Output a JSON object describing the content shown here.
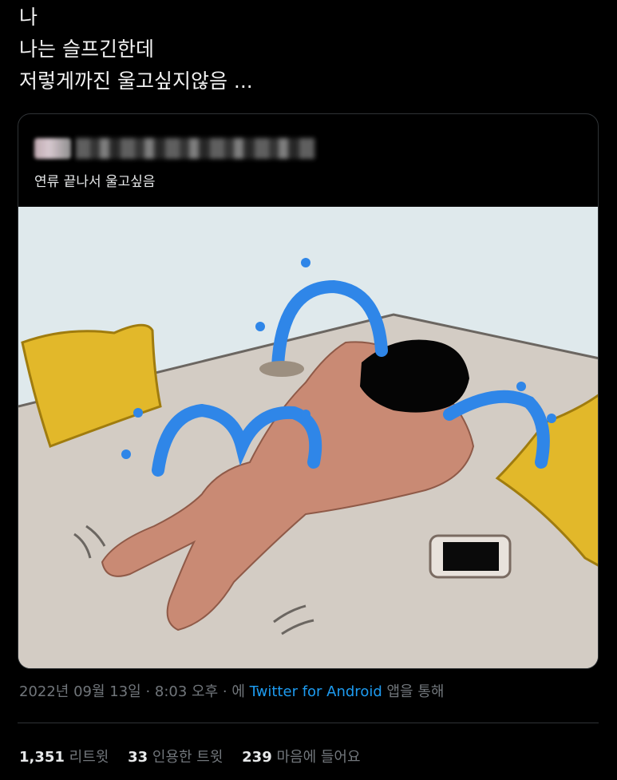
{
  "tweet": {
    "lines": [
      "나",
      "나는 슬프긴한데",
      "저렇게까진 울고싶지않음 ..."
    ]
  },
  "quote": {
    "text": "연류 끝나서 울고싶음"
  },
  "meta": {
    "datetime": "2022년 09월 13일 · 8:03 오후 · 에",
    "source": "Twitter for Android",
    "suffix": "앱을 통해"
  },
  "stats": {
    "retweets_count": "1,351",
    "retweets_label": "리트윗",
    "quotes_count": "33",
    "quotes_label": "인용한 트윗",
    "likes_count": "239",
    "likes_label": "마음에 들어요"
  },
  "colors": {
    "background": "#000000",
    "link": "#1d9bf0",
    "muted": "#71767b",
    "wall": "#dfe9ec",
    "bed": "#d3ccc4",
    "pillow": "#e2b82a",
    "skin": "#c98a74",
    "tears": "#2f86e8"
  }
}
